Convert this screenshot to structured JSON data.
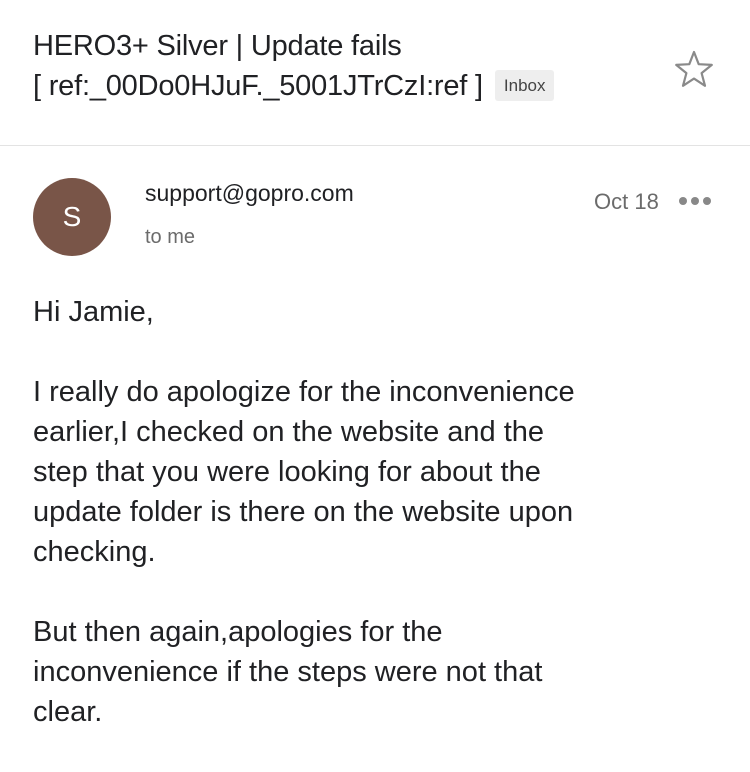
{
  "subject": {
    "lines": [
      "HERO3+ Silver | Update fails",
      "[ ref:_00Do0HJuF._5001JTrCzI:ref ]"
    ],
    "label": "Inbox"
  },
  "icons": {
    "star": "star-outline-icon",
    "more": "more-horizontal-icon"
  },
  "message": {
    "avatar_initial": "S",
    "avatar_color": "#795548",
    "sender": "support@gopro.com",
    "recipient": "to me",
    "date": "Oct 18"
  },
  "body": {
    "greeting": "Hi Jamie,",
    "paragraph1": [
      "I really do apologize for the inconvenience",
      "earlier,I checked on the website and the",
      "step that you were looking for about the",
      "update folder is there on the website upon",
      "checking."
    ],
    "paragraph2": [
      "But then again,apologies for the",
      "inconvenience if the steps were not that",
      "clear."
    ]
  }
}
